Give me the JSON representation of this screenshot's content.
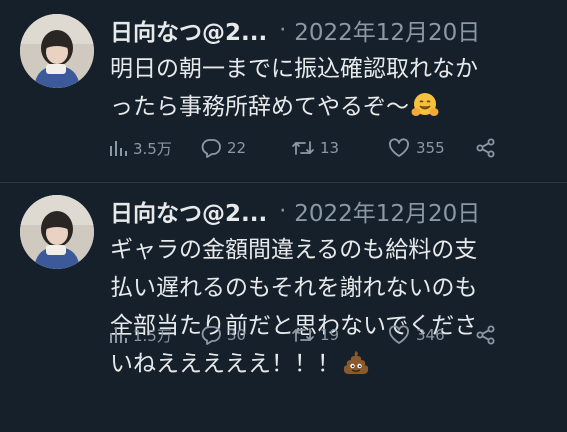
{
  "tweets": [
    {
      "name": "日向なつ@2...",
      "separator": "·",
      "date": "2022年12月20日",
      "lines": [
        "明日の朝一までに振込確認取れなか",
        "ったら事務所辞めてやるぞ〜"
      ],
      "trailing_emoji": "hugging-face-emoji",
      "views": "3.5万",
      "replies": "22",
      "retweets": "13",
      "likes": "355"
    },
    {
      "name": "日向なつ@2...",
      "separator": "·",
      "date": "2022年12月20日",
      "lines": [
        "ギャラの金額間違えるのも給料の支",
        "払い遅れるのもそれを謝れないのも",
        "全部当たり前だと思わないでくださ",
        "いねえええええ！！！"
      ],
      "trailing_emoji": "pile-of-poo-emoji",
      "views": "1.5万",
      "replies": "30",
      "retweets": "19",
      "likes": "346"
    }
  ],
  "icons": {
    "views": "bar-chart-icon",
    "reply": "speech-bubble-icon",
    "retweet": "retweet-arrows-icon",
    "like": "heart-icon",
    "share": "share-icon"
  },
  "colors": {
    "background": "#15202b",
    "text": "#e7e9ea",
    "secondary": "#8b98a5",
    "divider": "#2f3942"
  }
}
